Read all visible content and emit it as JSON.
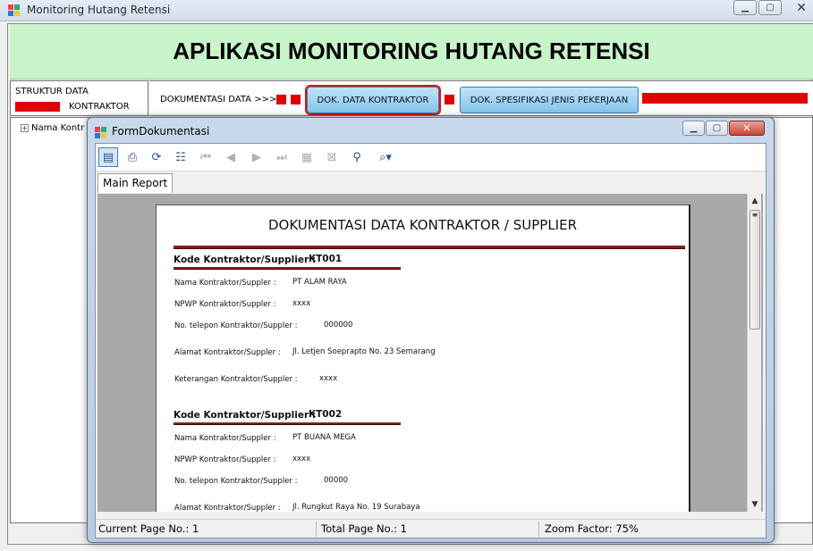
{
  "main_window": {
    "title": "Monitoring Hutang Retensi",
    "controls": {
      "minimize": "▁",
      "maximize": "▢",
      "close": "✕"
    }
  },
  "header": {
    "app_title": "APLIKASI MONITORING HUTANG RETENSI"
  },
  "struktur": {
    "label": "STRUKTUR DATA",
    "item": "KONTRAKTOR"
  },
  "nav": {
    "label": "DOKUMENTASI DATA >>>",
    "btn_kontraktor": "DOK. DATA KONTRAKTOR",
    "btn_spesifikasi": "DOK. SPESIFIKASI JENIS PEKERJAAN"
  },
  "tree": {
    "node": "Nama Kontr"
  },
  "child_window": {
    "title": "FormDokumentasi",
    "controls": {
      "minimize": "▁",
      "maximize": "▢",
      "close": "✕"
    }
  },
  "toolbar": {
    "icons": [
      "export-icon",
      "print-icon",
      "refresh-icon",
      "group-tree-icon",
      "first-page-icon",
      "prev-page-icon",
      "next-page-icon",
      "last-page-icon",
      "goto-page-icon",
      "stop-icon",
      "search-icon",
      "zoom-icon"
    ]
  },
  "tabs": {
    "main": "Main Report"
  },
  "report": {
    "title": "DOKUMENTASI DATA KONTRAKTOR / SUPPLIER",
    "kode_label": "Kode Kontraktor/Supplier :",
    "labels": {
      "nama": "Nama Kontraktor/Suppler :",
      "npwp": "NPWP Kontraktor/Suppler :",
      "telepon": "No. telepon Kontraktor/Suppler :",
      "alamat": "Alamat Kontraktor/Suppler :",
      "keterangan": "Keterangan Kontraktor/Suppler :"
    },
    "records": [
      {
        "kode": "KT001",
        "nama": "PT ALAM RAYA",
        "npwp": "xxxx",
        "telepon": "000000",
        "alamat": "Jl. Letjen Soeprapto No. 23 Semarang",
        "keterangan": "xxxx"
      },
      {
        "kode": "KT002",
        "nama": "PT BUANA MEGA",
        "npwp": "xxxx",
        "telepon": "00000",
        "alamat": "Jl. Rungkut Raya No. 19 Surabaya"
      }
    ]
  },
  "status": {
    "current_page": "Current Page No.: 1",
    "total_page": "Total Page No.: 1",
    "zoom": "Zoom Factor: 75%"
  },
  "colors": {
    "header_bg": "#c7f4c8",
    "accent_red": "#e00000",
    "button_blue": "#84c5ec",
    "rule_dark_red": "#8b1a1a"
  }
}
